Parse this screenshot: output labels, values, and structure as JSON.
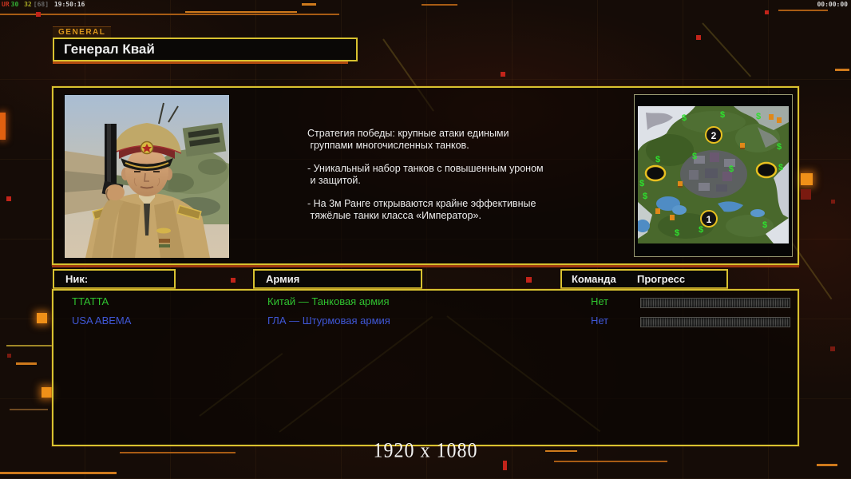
{
  "hud": {
    "perf_overlay": {
      "label": "UR",
      "fps": "30",
      "ping": "32",
      "extra": "[68]",
      "clock": "19:50:16"
    },
    "timer": "00:00:00"
  },
  "header": {
    "tab_label": "GENERAL",
    "title": "Генерал Квай"
  },
  "info_panel": {
    "description_paragraphs": [
      "Стратегия победы: крупные атаки едиными\n группами многочисленных танков.",
      "- Уникальный набор танков с повышенным уроном\n и защитой.",
      "- На 3м Ранге открываются крайне эффективные\n тяжёлые танки класса «Император»."
    ],
    "minimap": {
      "spawn_labels": [
        "1",
        "2"
      ],
      "money_icon": "$"
    }
  },
  "table": {
    "headers": {
      "nick": "Ник:",
      "army": "Армия",
      "team": "Команда",
      "progress": "Прогресс"
    },
    "rows": [
      {
        "nick": "TTATTA",
        "army": "Китай — Танковая армия",
        "team": "Нет",
        "progress_percent": 0
      },
      {
        "nick": "USA ABEMA",
        "army": "ГЛА — Штурмовая армия",
        "team": "Нет",
        "progress_percent": 0
      }
    ]
  },
  "footer": {
    "resolution": "1920 x 1080"
  },
  "colors": {
    "accent_yellow": "#d8c230",
    "accent_orange": "#c06018",
    "deco_red": "#c2241a",
    "player1_green": "#2fc22f",
    "player2_blue": "#3f57d6"
  }
}
